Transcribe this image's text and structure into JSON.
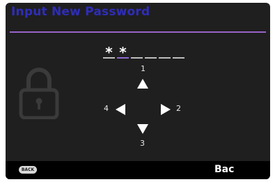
{
  "title": "Input New Password",
  "password": {
    "slots": [
      "*",
      "*",
      "",
      "",
      "",
      ""
    ],
    "active_slot": 1
  },
  "directions": {
    "up": "1",
    "left": "4",
    "right": "2",
    "down": "3"
  },
  "footer": {
    "back_button": "BACK",
    "back_label": "Bac"
  },
  "colors": {
    "title": "#2f2db8",
    "divider": "#9a63c9",
    "active_underline": "#8e6ad0",
    "background": "#1f1f1f"
  },
  "icons": [
    "lock-icon",
    "arrow-up-icon",
    "arrow-left-icon",
    "arrow-right-icon",
    "arrow-down-icon"
  ]
}
